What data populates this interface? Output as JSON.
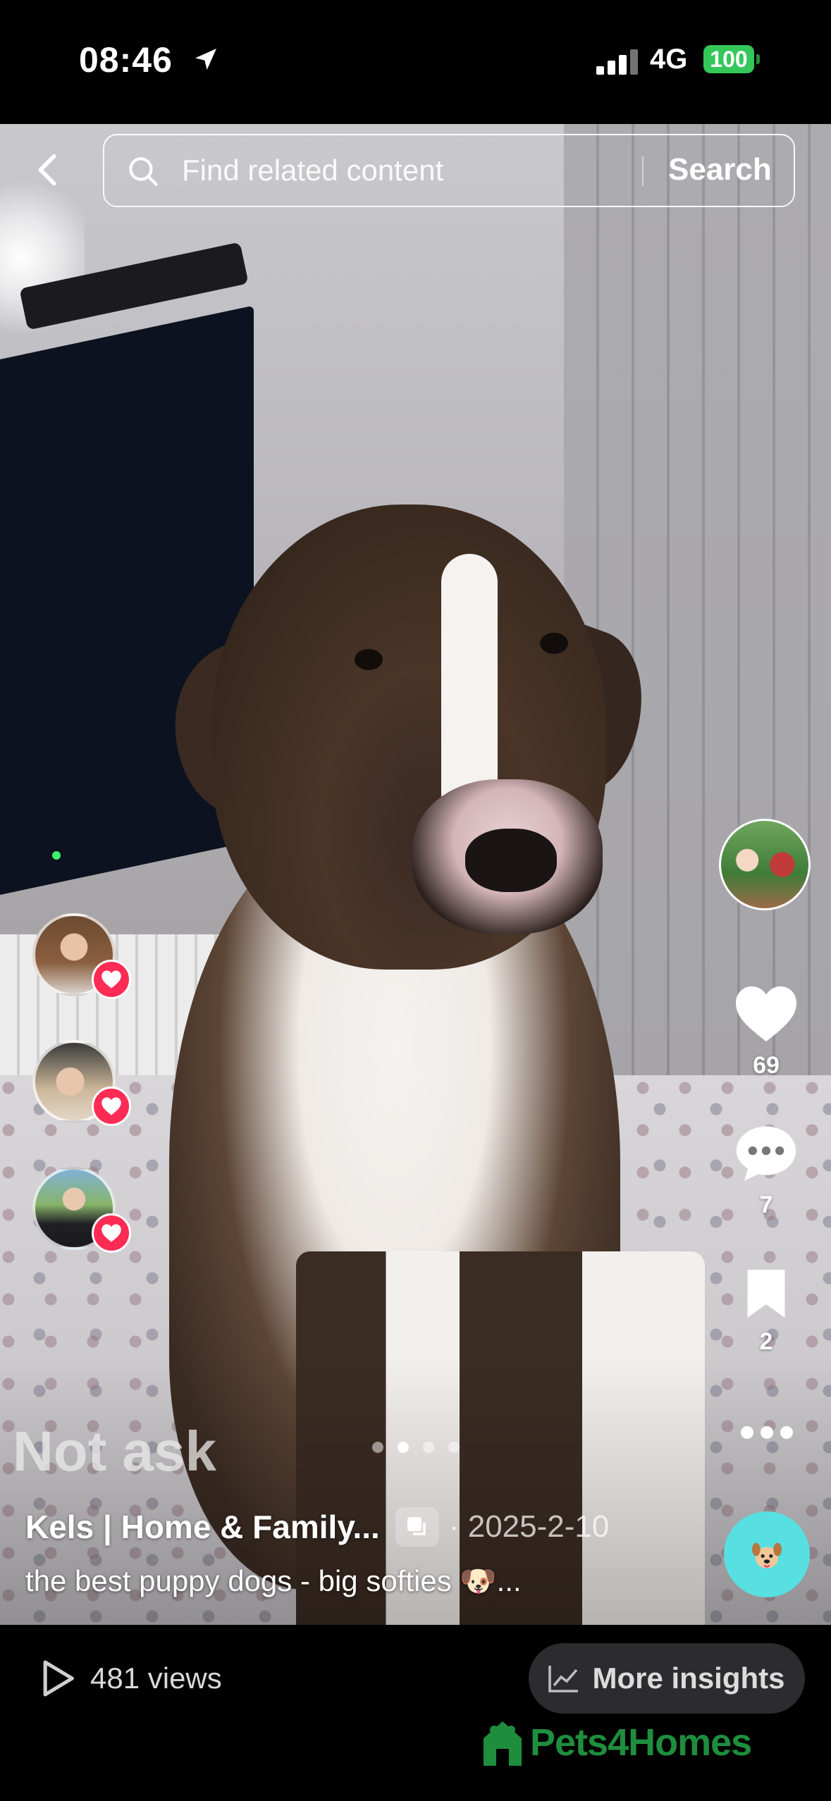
{
  "status_bar": {
    "time": "08:46",
    "network": "4G",
    "battery": "100"
  },
  "search": {
    "placeholder": "Find related content",
    "button_label": "Search"
  },
  "right_rail": {
    "likes": "69",
    "comments": "7",
    "saves": "2"
  },
  "video": {
    "overlay_title": "Not ask",
    "author": "Kels | Home & Family...",
    "date": "· 2025-2-10",
    "caption": "the best puppy dogs - big softies 🐶...",
    "carousel": {
      "count": 4,
      "active": 1
    }
  },
  "bottom_bar": {
    "views": "481 views",
    "insights_label": "More insights",
    "watermark": "Pets4Homes"
  },
  "colors": {
    "heart_badge": "#fe2c55",
    "fab": "#57dfe1",
    "battery": "#34c759",
    "watermark": "#1e8e3e"
  },
  "icons": [
    "location-arrow-icon",
    "back-icon",
    "search-icon",
    "heart-icon",
    "comment-icon",
    "bookmark-icon",
    "more-icon",
    "play-icon",
    "insights-icon",
    "pet-icon"
  ]
}
